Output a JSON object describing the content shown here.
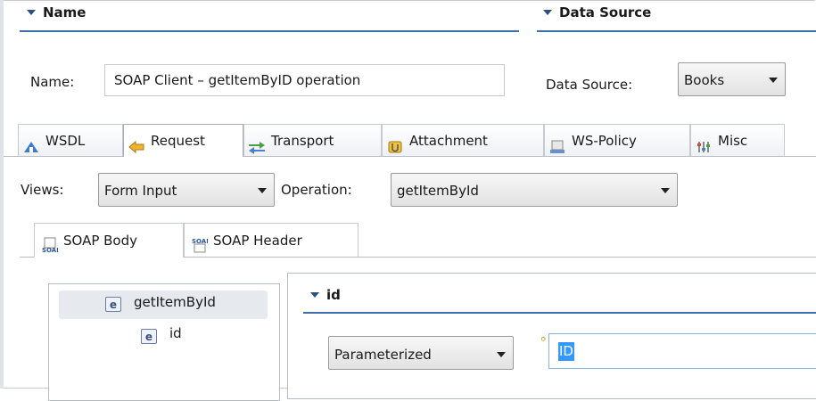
{
  "name_section": {
    "title": "Name",
    "label": "Name:",
    "value": "SOAP Client – getItemByID operation"
  },
  "datasource_section": {
    "title": "Data Source",
    "label": "Data Source:",
    "value": "Books"
  },
  "tabs": [
    {
      "label": "WSDL",
      "icon": "wsdl-icon"
    },
    {
      "label": "Request",
      "icon": "request-icon",
      "active": true
    },
    {
      "label": "Transport",
      "icon": "transport-icon"
    },
    {
      "label": "Attachment",
      "icon": "attachment-icon"
    },
    {
      "label": "WS-Policy",
      "icon": "ws-policy-icon"
    },
    {
      "label": "Misc",
      "icon": "misc-icon"
    }
  ],
  "views": {
    "label": "Views:",
    "value": "Form Input"
  },
  "operation": {
    "label": "Operation:",
    "value": "getItemById"
  },
  "subtabs": [
    {
      "label": "SOAP Body",
      "icon": "soap-body-icon",
      "active": true
    },
    {
      "label": "SOAP Header",
      "icon": "soap-header-icon"
    }
  ],
  "tree": [
    {
      "badge": "e",
      "label": "getItemById",
      "selected": true
    },
    {
      "badge": "e",
      "label": "id"
    }
  ],
  "id_section": {
    "title": "id",
    "mode": "Parameterized",
    "value": "ID"
  },
  "colors": {
    "accent": "#3f6fa8",
    "selection": "#3399ff"
  }
}
